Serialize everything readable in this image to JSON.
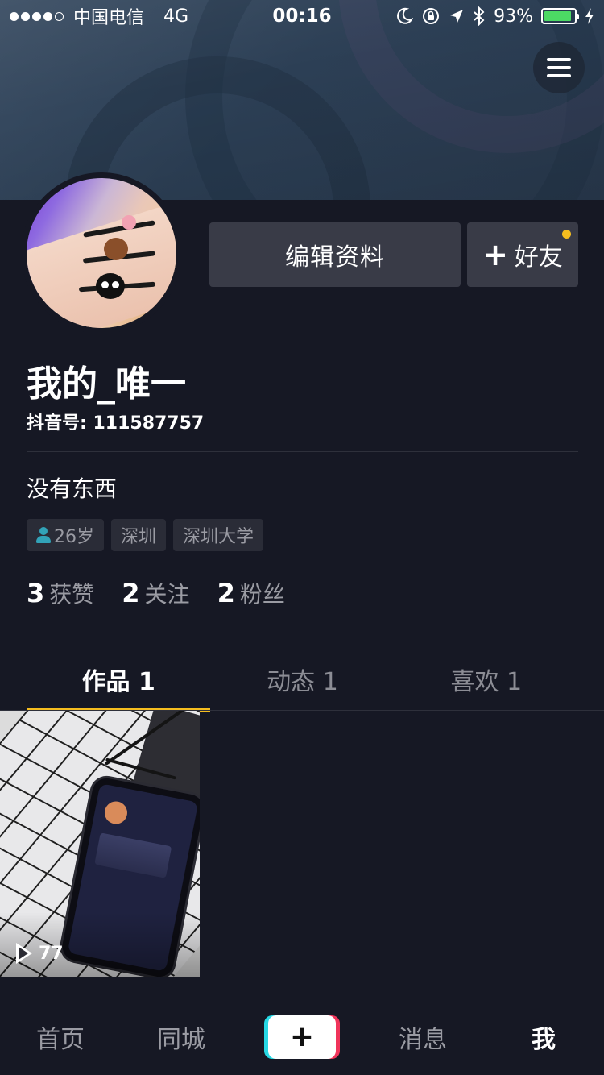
{
  "status_bar": {
    "carrier": "中国电信",
    "network": "4G",
    "time": "00:16",
    "battery": "93%",
    "battery_level": 0.93
  },
  "profile": {
    "nickname": "我的_唯一",
    "douyin_id": "抖音号: 111587757",
    "bio": "没有东西",
    "tags": {
      "age": "26岁",
      "city": "深圳",
      "school": "深圳大学"
    },
    "stats": [
      {
        "num": "3",
        "label": "获赞"
      },
      {
        "num": "2",
        "label": "关注"
      },
      {
        "num": "2",
        "label": "粉丝"
      }
    ]
  },
  "actions": {
    "edit_profile": "编辑资料",
    "add_friend": "好友"
  },
  "tabs": [
    {
      "label": "作品 1",
      "active": true
    },
    {
      "label": "动态 1",
      "active": false
    },
    {
      "label": "喜欢 1",
      "active": false
    }
  ],
  "videos": [
    {
      "play_count": "77"
    }
  ],
  "bottom_nav": {
    "home": "首页",
    "local": "同城",
    "messages": "消息",
    "me": "我"
  },
  "colors": {
    "background": "#161824",
    "accent": "#f5bd1f",
    "button": "#393b47",
    "tag_bg": "#2a2c37",
    "muted_text": "#9a9ba3",
    "battery": "#4cd964",
    "tiktok_cyan": "#27d8e4",
    "tiktok_red": "#f0345a"
  },
  "icons": [
    "menu-icon",
    "moon-icon",
    "rotation-lock-icon",
    "location-arrow-icon",
    "bluetooth-icon",
    "battery-icon",
    "charging-icon",
    "plus-icon",
    "person-icon",
    "play-icon"
  ]
}
